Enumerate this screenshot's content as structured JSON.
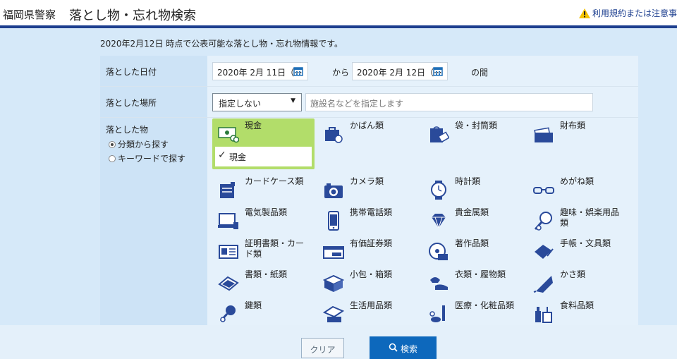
{
  "header": {
    "org": "福岡県警察",
    "title": "落とし物・忘れ物検索",
    "notice": "利用規約または注意事"
  },
  "intro": "2020年2月12日 時点で公表可能な落とし物・忘れ物情報です。",
  "form": {
    "date_label": "落とした日付",
    "date_from": "2020年 2月 11日（···",
    "kara": "から",
    "date_to": "2020年 2月 12日（···",
    "noma": "の間",
    "place_label": "落とした場所",
    "place_select": "指定しない",
    "place_placeholder": "施設名などを指定します",
    "item_label": "落とした物",
    "mode_category": "分類から探す",
    "mode_keyword": "キーワードで探す"
  },
  "categories": [
    {
      "label": "現金",
      "icon": "cash-icon",
      "selected": true,
      "sub": "現金"
    },
    {
      "label": "かばん類",
      "icon": "bag-icon"
    },
    {
      "label": "袋・封筒類",
      "icon": "envelope-icon"
    },
    {
      "label": "財布類",
      "icon": "wallet-icon"
    },
    {
      "label": "カードケース類",
      "icon": "card-case-icon"
    },
    {
      "label": "カメラ類",
      "icon": "camera-icon"
    },
    {
      "label": "時計類",
      "icon": "watch-icon"
    },
    {
      "label": "めがね類",
      "icon": "glasses-icon"
    },
    {
      "label": "電気製品類",
      "icon": "electronics-icon"
    },
    {
      "label": "携帯電話類",
      "icon": "phone-icon"
    },
    {
      "label": "貴金属類",
      "icon": "jewel-icon"
    },
    {
      "label": "趣味・娯楽用品類",
      "icon": "hobby-icon"
    },
    {
      "label": "証明書類・カード類",
      "icon": "id-card-icon"
    },
    {
      "label": "有価証券類",
      "icon": "ticket-icon"
    },
    {
      "label": "著作品類",
      "icon": "disc-icon"
    },
    {
      "label": "手帳・文具類",
      "icon": "notebook-icon"
    },
    {
      "label": "書類・紙類",
      "icon": "papers-icon"
    },
    {
      "label": "小包・箱類",
      "icon": "box-icon"
    },
    {
      "label": "衣類・履物類",
      "icon": "clothes-icon"
    },
    {
      "label": "かさ類",
      "icon": "umbrella-icon"
    },
    {
      "label": "鍵類",
      "icon": "key-icon"
    },
    {
      "label": "生活用品類",
      "icon": "daily-goods-icon"
    },
    {
      "label": "医療・化粧品類",
      "icon": "medical-icon"
    },
    {
      "label": "食料品類",
      "icon": "food-icon"
    }
  ],
  "buttons": {
    "clear": "クリア",
    "search": "検索"
  },
  "colors": {
    "accent": "#0d68bc",
    "selected": "#b2dd6a",
    "icon": "#2a4a9a"
  }
}
